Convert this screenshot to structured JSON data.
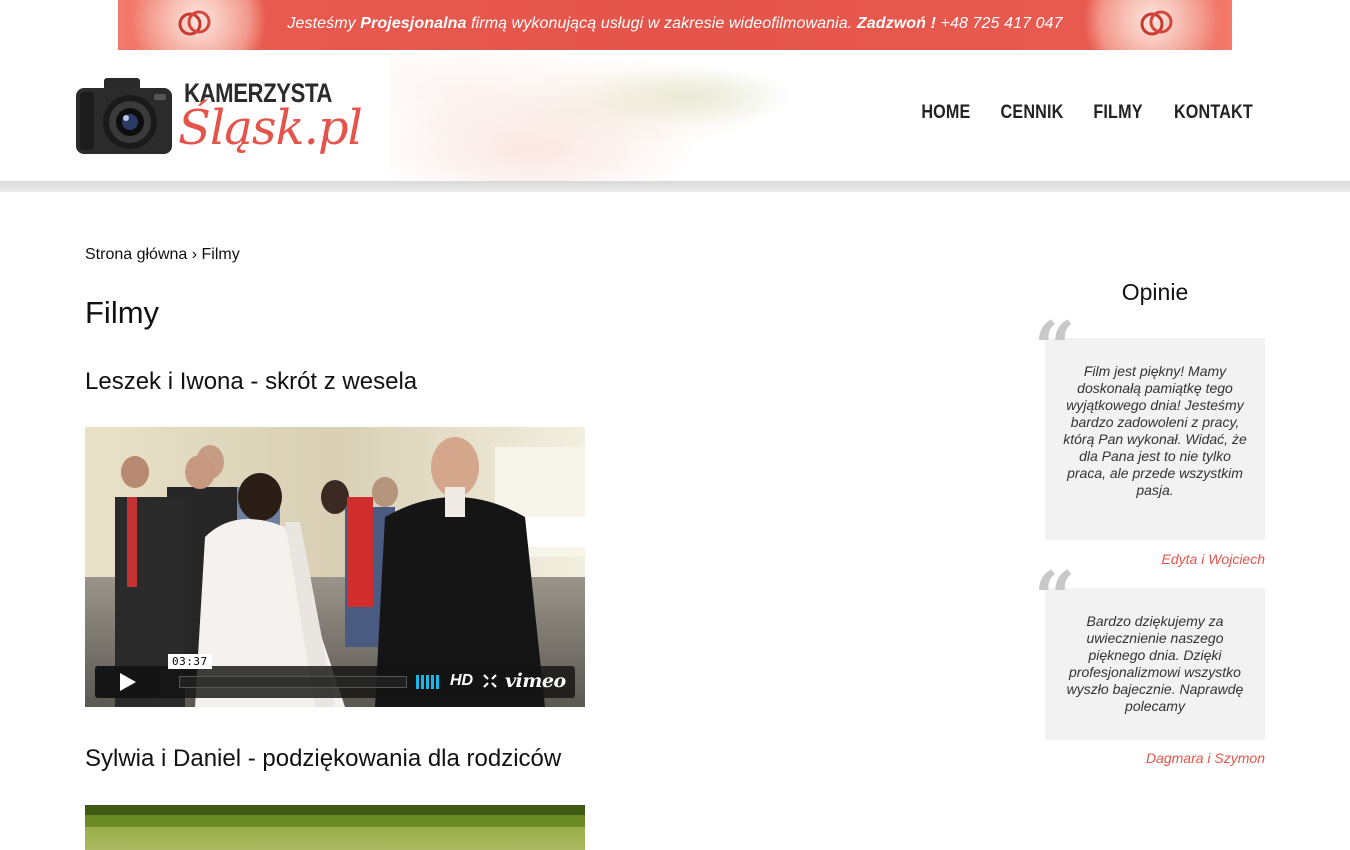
{
  "topbar": {
    "text_prefix": "Jesteśmy ",
    "text_bold": "Projesjonalna",
    "text_mid": " firmą wykonującą usługi w zakresie wideofilmowania. ",
    "call_label": "Zadzwoń !",
    "phone": " +48 725 417 047"
  },
  "logo": {
    "top_text": "KAMERZYSTA",
    "script_text": "Śląsk.pl"
  },
  "nav": {
    "items": [
      {
        "label": "HOME"
      },
      {
        "label": "CENNIK"
      },
      {
        "label": "FILMY"
      },
      {
        "label": "KONTAKT"
      }
    ]
  },
  "breadcrumb": {
    "home": "Strona główna",
    "separator": " › ",
    "current": "Filmy"
  },
  "page": {
    "title": "Filmy"
  },
  "films": [
    {
      "title": "Leszek i Iwona - skrót z wesela",
      "player": {
        "time": "03:37",
        "hd_label": "HD",
        "brand": "vimeo",
        "progress": 0
      }
    },
    {
      "title": "Sylwia i Daniel - podziękowania dla rodziców"
    }
  ],
  "sidebar": {
    "title": "Opinie",
    "quote_mark": "“",
    "testimonials": [
      {
        "text": "Film jest piękny! Mamy doskonałą pamiątkę tego wyjątkowego dnia! Jesteśmy bardzo zadowoleni z pracy, którą Pan wykonał. Widać, że dla Pana jest to nie tylko praca, ale przede wszystkim pasja.",
        "author": "Edyta i Wojciech"
      },
      {
        "text": "Bardzo dziękujemy za uwiecznienie naszego pięknego dnia. Dzięki profesjonalizmowi wszystko wyszło bajecznie. Naprawdę polecamy",
        "author": "Dagmara i Szymon"
      }
    ]
  },
  "colors": {
    "accent": "#e4544a",
    "quote_bg": "#f2f2f2",
    "player_bar": "#141414"
  }
}
